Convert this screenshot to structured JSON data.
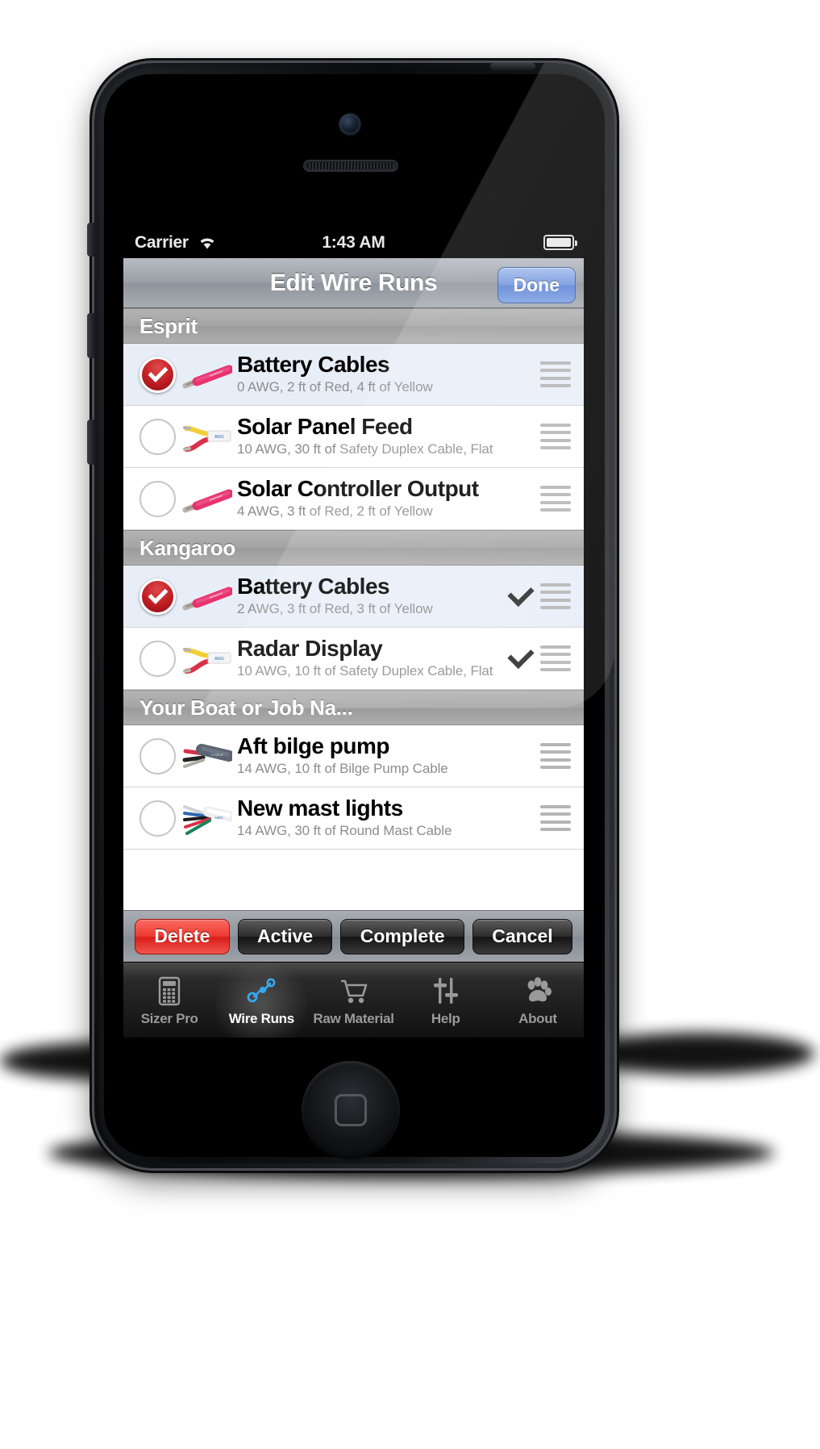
{
  "status_bar": {
    "carrier": "Carrier",
    "wifi_icon": "wifi-icon",
    "time": "1:43 AM",
    "battery_icon": "battery-icon"
  },
  "nav_bar": {
    "title": "Edit Wire Runs",
    "done_label": "Done"
  },
  "list": {
    "sections": [
      {
        "header": "Esprit",
        "rows": [
          {
            "title": "Battery Cables",
            "subtitle": "0 AWG, 2 ft of Red, 4 ft of Yellow",
            "selected": true,
            "checked": false,
            "thumb": "single-red-wire"
          },
          {
            "title": "Solar Panel Feed",
            "subtitle": "10 AWG, 30 ft of Safety Duplex Cable, Flat",
            "selected": false,
            "checked": false,
            "thumb": "duplex-flat-cable"
          },
          {
            "title": "Solar Controller Output",
            "subtitle": "4 AWG, 3 ft of Red, 2 ft of Yellow",
            "selected": false,
            "checked": false,
            "thumb": "single-red-wire"
          }
        ]
      },
      {
        "header": "Kangaroo",
        "rows": [
          {
            "title": "Battery Cables",
            "subtitle": "2 AWG, 3 ft of Red, 3 ft of Yellow",
            "selected": true,
            "checked": true,
            "thumb": "single-red-wire"
          },
          {
            "title": "Radar Display",
            "subtitle": "10 AWG, 10 ft of Safety Duplex Cable, Flat",
            "selected": false,
            "checked": true,
            "thumb": "duplex-flat-cable"
          }
        ]
      },
      {
        "header": "Your Boat or Job Na...",
        "rows": [
          {
            "title": "Aft bilge pump",
            "subtitle": "14 AWG, 10 ft of Bilge Pump Cable",
            "selected": false,
            "checked": false,
            "thumb": "bilge-pump-cable"
          },
          {
            "title": "New mast lights",
            "subtitle": "14 AWG, 30 ft of Round Mast Cable",
            "selected": false,
            "checked": false,
            "thumb": "round-mast-cable"
          }
        ]
      }
    ]
  },
  "action_bar": {
    "buttons": [
      {
        "label": "Delete",
        "style": "danger"
      },
      {
        "label": "Active",
        "style": "dark"
      },
      {
        "label": "Complete",
        "style": "dark"
      },
      {
        "label": "Cancel",
        "style": "dark"
      }
    ]
  },
  "tab_bar": {
    "tabs": [
      {
        "label": "Sizer Pro",
        "icon": "calculator-icon",
        "active": false
      },
      {
        "label": "Wire Runs",
        "icon": "nodes-graph-icon",
        "active": true
      },
      {
        "label": "Raw Material",
        "icon": "cart-icon",
        "active": false
      },
      {
        "label": "Help",
        "icon": "sliders-icon",
        "active": false
      },
      {
        "label": "About",
        "icon": "paw-print-icon",
        "active": false
      }
    ]
  },
  "colors": {
    "accent_blue": "#5b82d6",
    "danger_red": "#d81e18",
    "selected_row": "#e8eef8",
    "section_gray": "#a4a4a4"
  }
}
